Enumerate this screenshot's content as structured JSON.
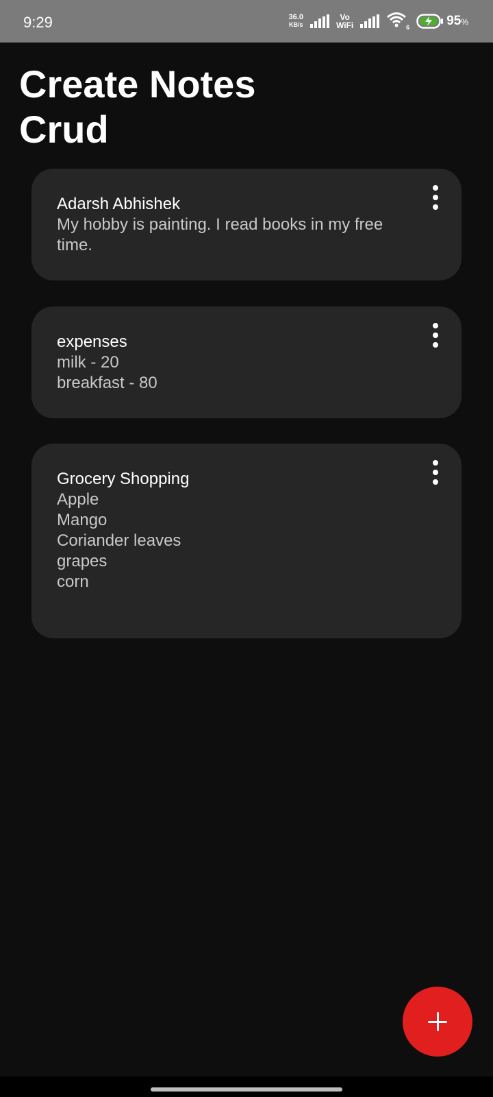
{
  "status_bar": {
    "time": "9:29",
    "net_speed_value": "36.0",
    "net_speed_unit": "KB/s",
    "vo_label": "Vo",
    "wifi_label": "WiFi",
    "wifi_slot": "6",
    "battery_percent": "95",
    "battery_percent_sign": "%",
    "battery_color": "#4caf2e",
    "icons": [
      "signal-icon",
      "vowifi-signal-icon",
      "wifi-icon",
      "battery-charging-icon"
    ]
  },
  "page": {
    "title": "Create Notes\nCrud"
  },
  "notes": [
    {
      "title": "Adarsh Abhishek",
      "body": "My hobby is painting. I read books in my free time."
    },
    {
      "title": "expenses",
      "body": "milk - 20\nbreakfast - 80"
    },
    {
      "title": "Grocery Shopping",
      "body": "Apple\nMango\nCoriander leaves\ngrapes\ncorn"
    }
  ],
  "fab": {
    "icon": "plus-icon",
    "color": "#e21f1f"
  },
  "colors": {
    "background": "#0e0e0e",
    "card": "#262626",
    "status_bar": "#7b7b7b"
  }
}
